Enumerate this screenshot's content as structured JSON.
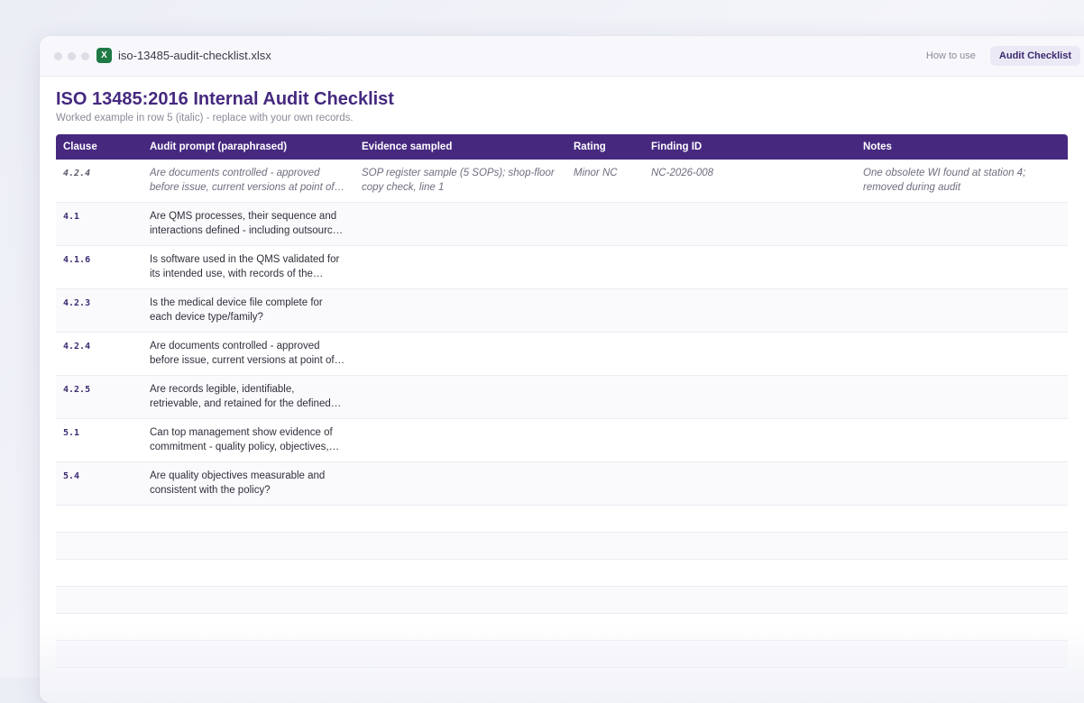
{
  "window": {
    "filename": "iso-13485-audit-checklist.xlsx",
    "file_icon_letter": "X",
    "tabs": [
      {
        "label": "How to use",
        "active": false
      },
      {
        "label": "Audit Checklist",
        "active": true
      }
    ]
  },
  "sheet": {
    "title": "ISO 13485:2016 Internal Audit Checklist",
    "subtitle": "Worked example in row 5 (italic) - replace with your own records.",
    "columns": [
      "Clause",
      "Audit prompt (paraphrased)",
      "Evidence sampled",
      "Rating",
      "Finding ID",
      "Notes"
    ],
    "rows": [
      {
        "clause": "4.2.4",
        "prompt": "Are documents controlled - approved before issue, current versions at point of use?",
        "evidence": "SOP register sample (5 SOPs); shop-floor copy check, line 1",
        "rating": "Minor NC",
        "finding": "NC-2026-008",
        "notes": "One obsolete WI found at station 4; removed during audit",
        "example": true
      },
      {
        "clause": "4.1",
        "prompt": "Are QMS processes, their sequence and interactions defined - including outsourced processes?",
        "evidence": "",
        "rating": "",
        "finding": "",
        "notes": ""
      },
      {
        "clause": "4.1.6",
        "prompt": "Is software used in the QMS validated for its intended use, with records of the validation?",
        "evidence": "",
        "rating": "",
        "finding": "",
        "notes": ""
      },
      {
        "clause": "4.2.3",
        "prompt": "Is the medical device file complete for each device type/family?",
        "evidence": "",
        "rating": "",
        "finding": "",
        "notes": ""
      },
      {
        "clause": "4.2.4",
        "prompt": "Are documents controlled - approved before issue, current versions at point of use?",
        "evidence": "",
        "rating": "",
        "finding": "",
        "notes": ""
      },
      {
        "clause": "4.2.5",
        "prompt": "Are records legible, identifiable, retrievable, and retained for the defined period?",
        "evidence": "",
        "rating": "",
        "finding": "",
        "notes": ""
      },
      {
        "clause": "5.1",
        "prompt": "Can top management show evidence of commitment - quality policy, objectives, reviews?",
        "evidence": "",
        "rating": "",
        "finding": "",
        "notes": ""
      },
      {
        "clause": "5.4",
        "prompt": "Are quality objectives measurable and consistent with the policy?",
        "evidence": "",
        "rating": "",
        "finding": "",
        "notes": ""
      }
    ]
  },
  "colors": {
    "accent": "#46297f",
    "excel_green": "#1f7a45"
  }
}
